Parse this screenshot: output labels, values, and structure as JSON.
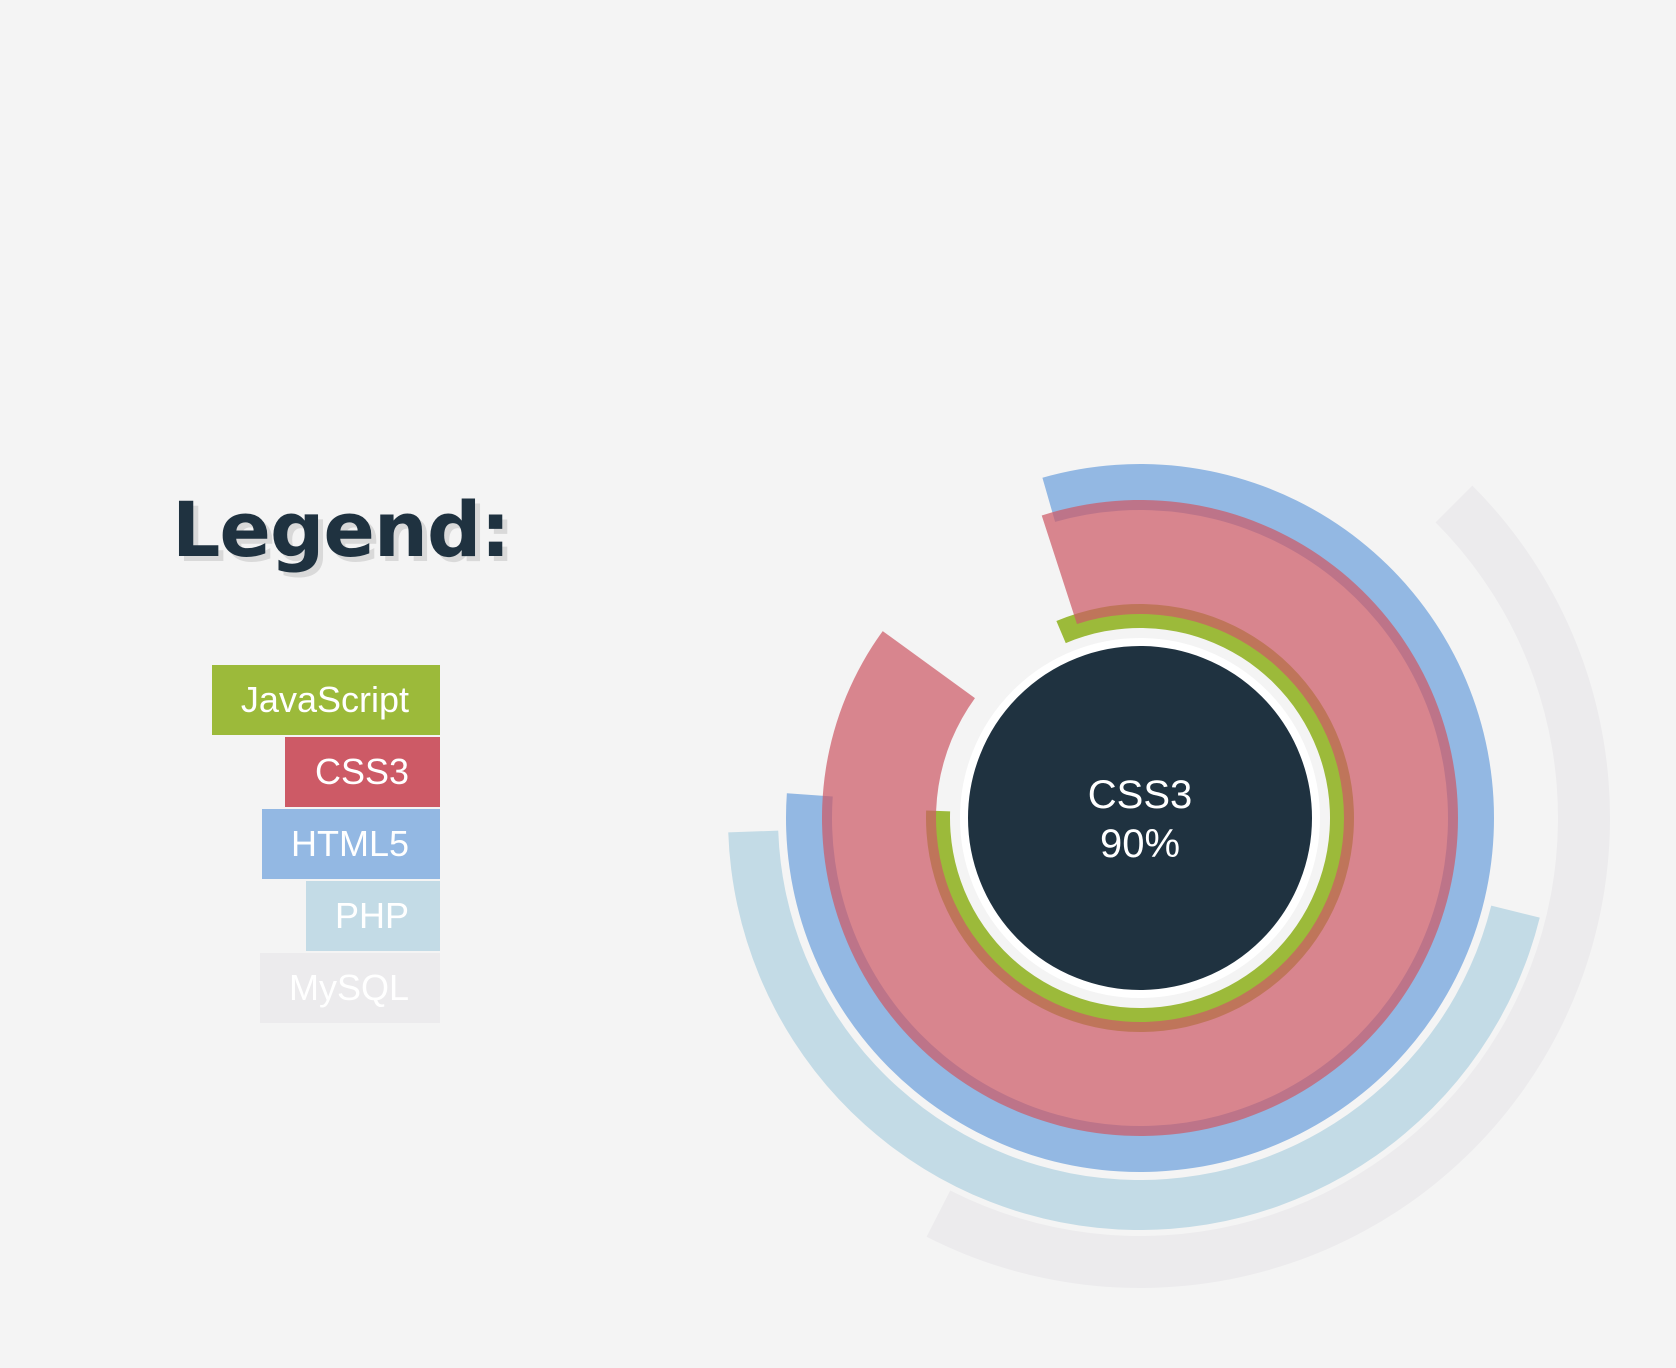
{
  "legend": {
    "title": "Legend:"
  },
  "chart_data": {
    "type": "radial-bar",
    "title": "",
    "series": [
      {
        "name": "JavaScript",
        "color": "#9cba3a",
        "start_deg": -23,
        "span_deg": 295
      },
      {
        "name": "CSS3",
        "color": "#cd5a66",
        "start_deg": -18,
        "span_deg": 324
      },
      {
        "name": "HTML5",
        "color": "#93b8e3",
        "start_deg": -16,
        "span_deg": 290
      },
      {
        "name": "PHP",
        "color": "#c3dbe6",
        "start_deg": 104,
        "span_deg": 164
      },
      {
        "name": "MySQL",
        "color": "#ecebed",
        "start_deg": 45,
        "span_deg": 162
      }
    ],
    "selected": {
      "name": "CSS3",
      "value": "90%"
    },
    "center_color": "#1f3240"
  }
}
